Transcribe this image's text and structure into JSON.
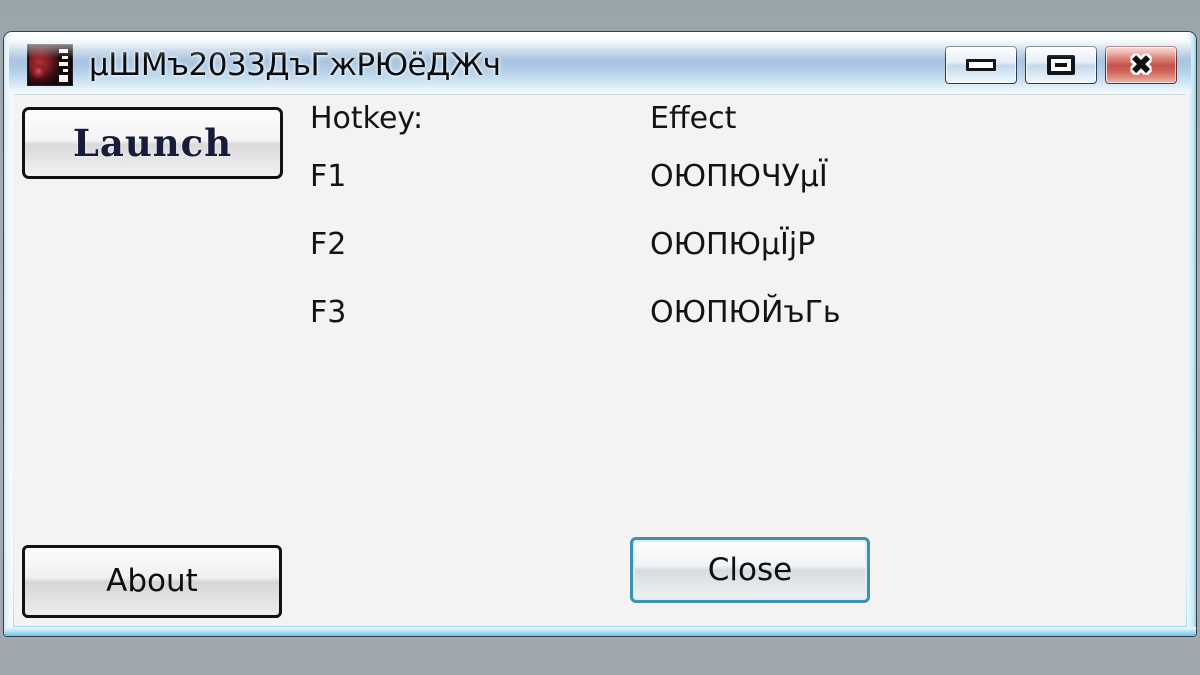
{
  "window": {
    "title": "µШМъ2033ДъЃжРЮёДЖч",
    "icon_name": "app-icon-dark-red",
    "controls": {
      "minimize_glyph": "minimize-icon",
      "maximize_glyph": "restore-icon",
      "close_glyph": "✖"
    },
    "colors": {
      "titlebar_accent": "#a9c5e1",
      "close_button": "#c1534a",
      "frame_edge": "#8fd4ee",
      "client_bg": "#f3f3f3",
      "launch_text": "#171c3a",
      "default_button_border": "#3c90b4"
    }
  },
  "main": {
    "launch_label": "Launch",
    "table": {
      "headers": {
        "hotkey": "Hotkey:",
        "effect": "Effect"
      },
      "rows": [
        {
          "hotkey": "F1",
          "effect": "ОЮПЮЧУµЇ"
        },
        {
          "hotkey": "F2",
          "effect": "ОЮПЮµЇјР"
        },
        {
          "hotkey": "F3",
          "effect": "ОЮПЮЙъГь"
        }
      ]
    }
  },
  "footer": {
    "about_label": "About",
    "close_label": "Close"
  }
}
